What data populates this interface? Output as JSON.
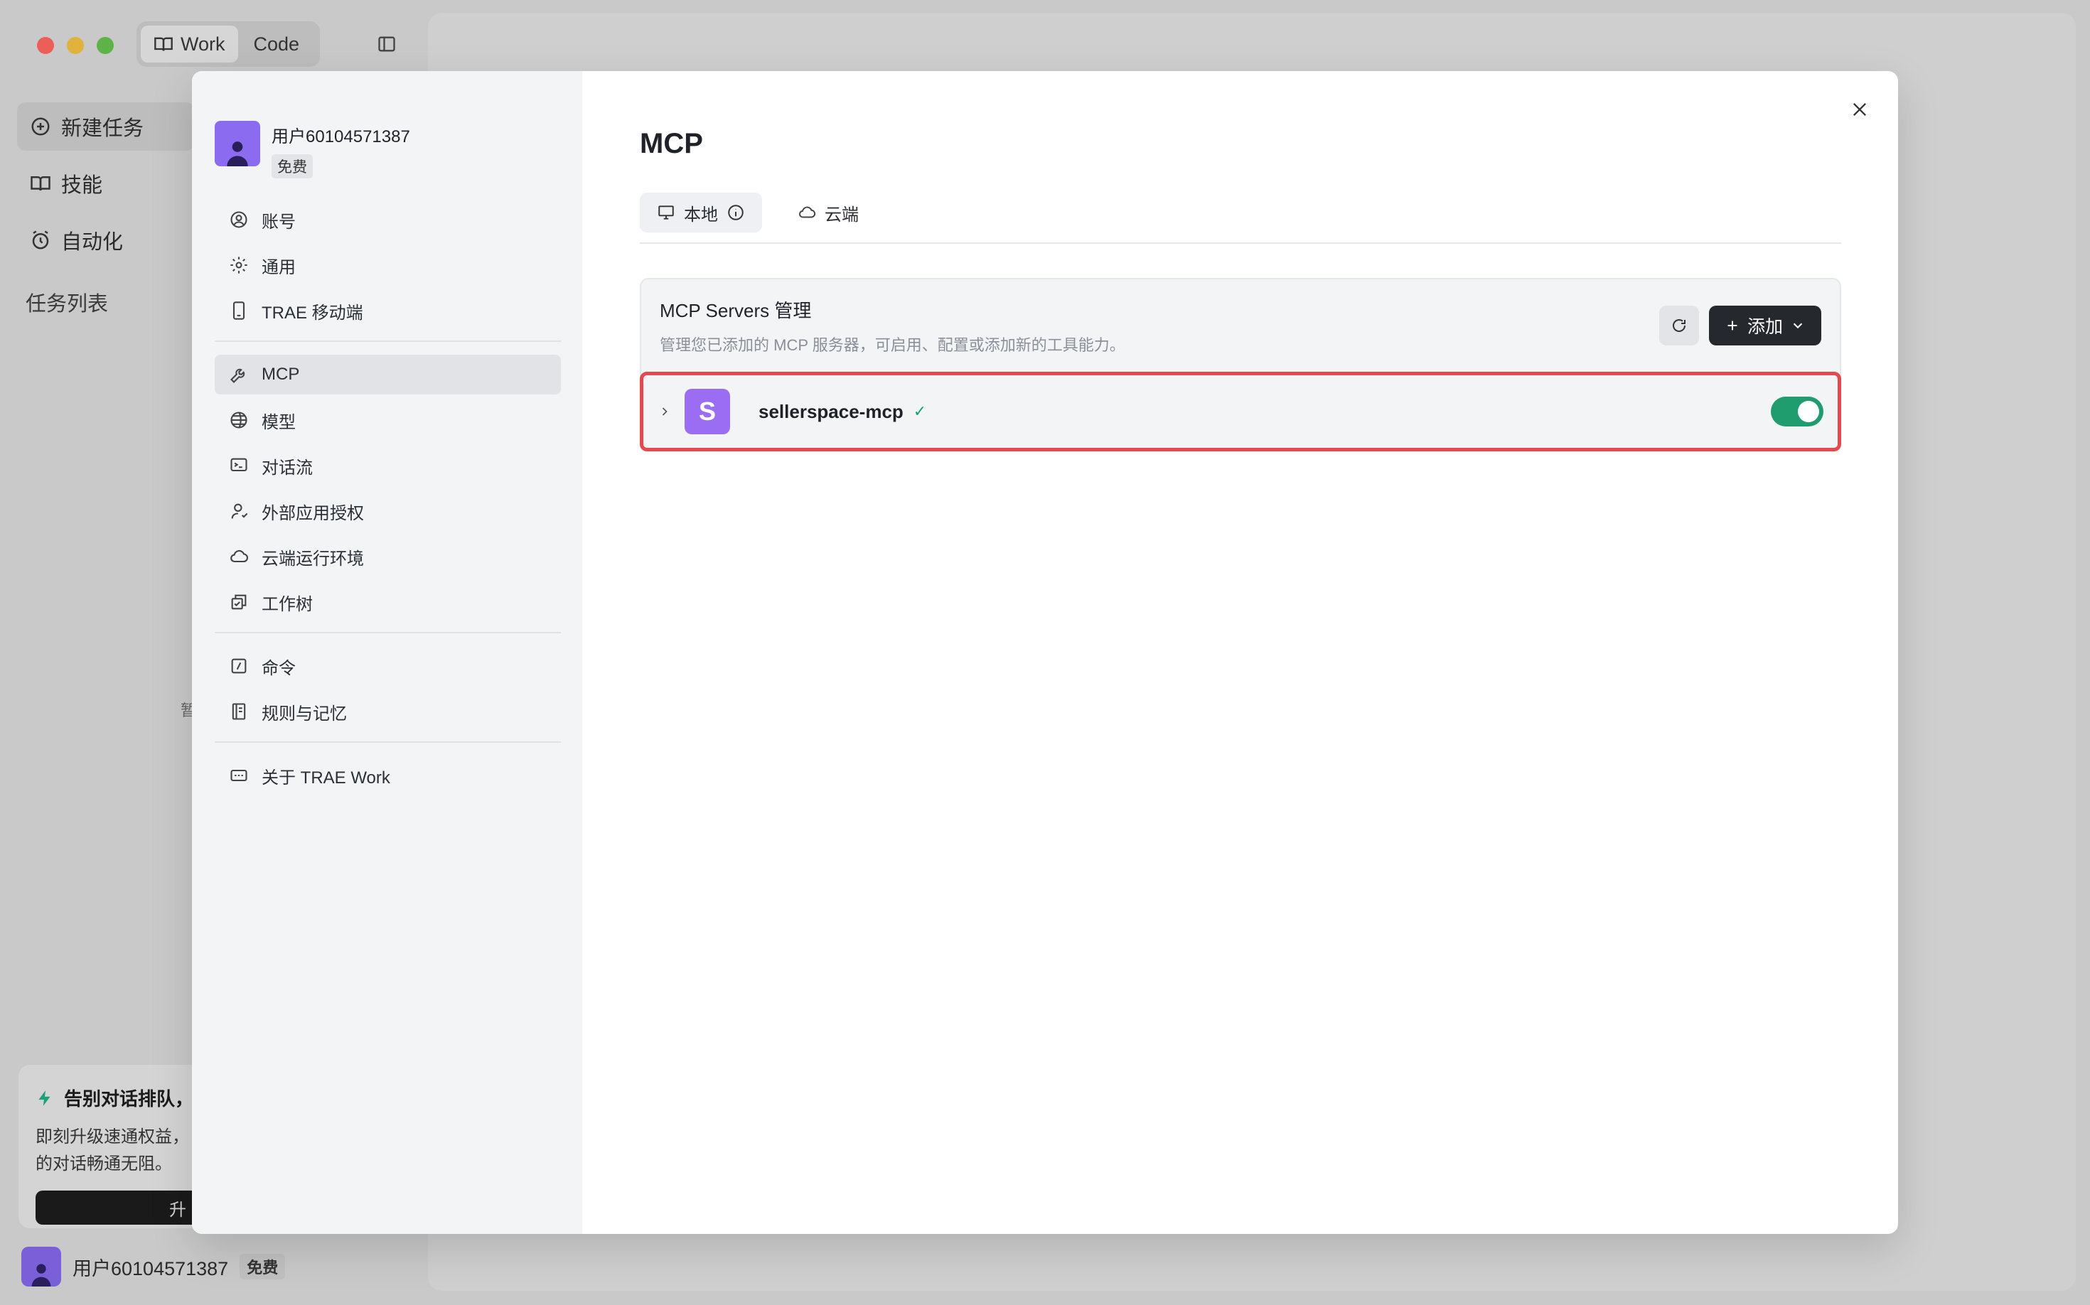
{
  "titlebar": {
    "modes": [
      {
        "label": "Work",
        "active": true
      },
      {
        "label": "Code",
        "active": false
      }
    ]
  },
  "background_sidebar": {
    "items": [
      {
        "label": "新建任务",
        "icon": "new-task-icon",
        "active": true
      },
      {
        "label": "技能",
        "icon": "book-icon",
        "active": false
      },
      {
        "label": "自动化",
        "icon": "alarm-icon",
        "active": false
      }
    ],
    "section_label": "任务列表",
    "stray_text": "暂",
    "promo": {
      "title": "告别对话排队，",
      "line1": "即刻升级速通权益，",
      "line2": "的对话畅通无阻。",
      "button": "升"
    },
    "user": {
      "name": "用户60104571387",
      "badge": "免费"
    }
  },
  "settings": {
    "profile": {
      "name": "用户60104571387",
      "badge": "免费"
    },
    "nav_groups": [
      [
        {
          "label": "账号",
          "icon": "account-icon"
        },
        {
          "label": "通用",
          "icon": "gear-icon"
        },
        {
          "label": "TRAE 移动端",
          "icon": "mobile-icon"
        }
      ],
      [
        {
          "label": "MCP",
          "icon": "wrench-icon",
          "active": true
        },
        {
          "label": "模型",
          "icon": "model-icon"
        },
        {
          "label": "对话流",
          "icon": "terminal-icon"
        },
        {
          "label": "外部应用授权",
          "icon": "user-auth-icon"
        },
        {
          "label": "云端运行环境",
          "icon": "cloud-icon"
        },
        {
          "label": "工作树",
          "icon": "worktree-icon"
        }
      ],
      [
        {
          "label": "命令",
          "icon": "slash-command-icon"
        },
        {
          "label": "规则与记忆",
          "icon": "notebook-icon"
        }
      ],
      [
        {
          "label": "关于 TRAE Work",
          "icon": "about-icon"
        }
      ]
    ]
  },
  "content": {
    "title": "MCP",
    "tabs": [
      {
        "label": "本地",
        "icon": "monitor-icon",
        "active": true
      },
      {
        "label": "云端",
        "icon": "cloud-icon",
        "active": false
      }
    ],
    "panel": {
      "title": "MCP Servers 管理",
      "description": "管理您已添加的 MCP 服务器，可启用、配置或添加新的工具能力。",
      "add_label": "添加"
    },
    "servers": [
      {
        "initial": "S",
        "name": "sellerspace-mcp",
        "status": "✓",
        "enabled": true
      }
    ]
  },
  "colors": {
    "accent_toggle": "#1f9d6e",
    "server_logo": "#9b6df2",
    "highlight_border": "#e5484d",
    "add_button": "#25282d"
  }
}
